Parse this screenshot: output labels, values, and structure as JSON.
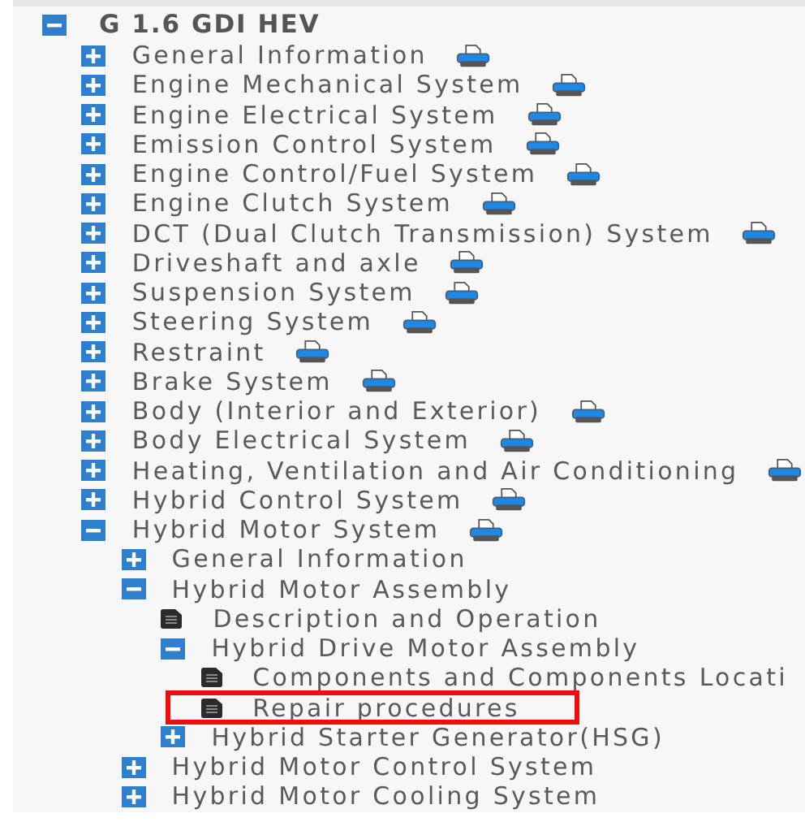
{
  "tree": [
    {
      "label": "G 1.6 GDI HEV",
      "kind": "folder",
      "expanded": true,
      "children": [
        {
          "label": "General Information",
          "kind": "folder",
          "expanded": false,
          "printable": true
        },
        {
          "label": "Engine Mechanical System",
          "kind": "folder",
          "expanded": false,
          "printable": true
        },
        {
          "label": "Engine Electrical System",
          "kind": "folder",
          "expanded": false,
          "printable": true
        },
        {
          "label": "Emission Control System",
          "kind": "folder",
          "expanded": false,
          "printable": true
        },
        {
          "label": "Engine Control/Fuel System",
          "kind": "folder",
          "expanded": false,
          "printable": true
        },
        {
          "label": "Engine Clutch System",
          "kind": "folder",
          "expanded": false,
          "printable": true
        },
        {
          "label": "DCT (Dual Clutch Transmission) System",
          "kind": "folder",
          "expanded": false,
          "printable": true
        },
        {
          "label": "Driveshaft and axle",
          "kind": "folder",
          "expanded": false,
          "printable": true
        },
        {
          "label": "Suspension System",
          "kind": "folder",
          "expanded": false,
          "printable": true
        },
        {
          "label": "Steering System",
          "kind": "folder",
          "expanded": false,
          "printable": true
        },
        {
          "label": "Restraint",
          "kind": "folder",
          "expanded": false,
          "printable": true
        },
        {
          "label": "Brake System",
          "kind": "folder",
          "expanded": false,
          "printable": true
        },
        {
          "label": "Body (Interior and Exterior)",
          "kind": "folder",
          "expanded": false,
          "printable": true
        },
        {
          "label": "Body Electrical System",
          "kind": "folder",
          "expanded": false,
          "printable": true
        },
        {
          "label": "Heating, Ventilation and Air Conditioning",
          "kind": "folder",
          "expanded": false,
          "printable": true
        },
        {
          "label": "Hybrid Control System",
          "kind": "folder",
          "expanded": false,
          "printable": true
        },
        {
          "label": "Hybrid Motor System",
          "kind": "folder",
          "expanded": true,
          "printable": true,
          "children": [
            {
              "label": "General Information",
              "kind": "folder",
              "expanded": false
            },
            {
              "label": "Hybrid Motor Assembly",
              "kind": "folder",
              "expanded": true,
              "children": [
                {
                  "label": "Description and Operation",
                  "kind": "doc"
                },
                {
                  "label": "Hybrid Drive Motor Assembly",
                  "kind": "folder",
                  "expanded": true,
                  "children": [
                    {
                      "label": "Components and Components Locati",
                      "kind": "doc"
                    },
                    {
                      "label": "Repair procedures",
                      "kind": "doc",
                      "highlighted": true
                    }
                  ]
                },
                {
                  "label": "Hybrid Starter Generator(HSG)",
                  "kind": "folder",
                  "expanded": false
                }
              ]
            },
            {
              "label": "Hybrid Motor Control System",
              "kind": "folder",
              "expanded": false
            },
            {
              "label": "Hybrid Motor Cooling System",
              "kind": "folder",
              "expanded": false
            }
          ]
        }
      ]
    }
  ]
}
